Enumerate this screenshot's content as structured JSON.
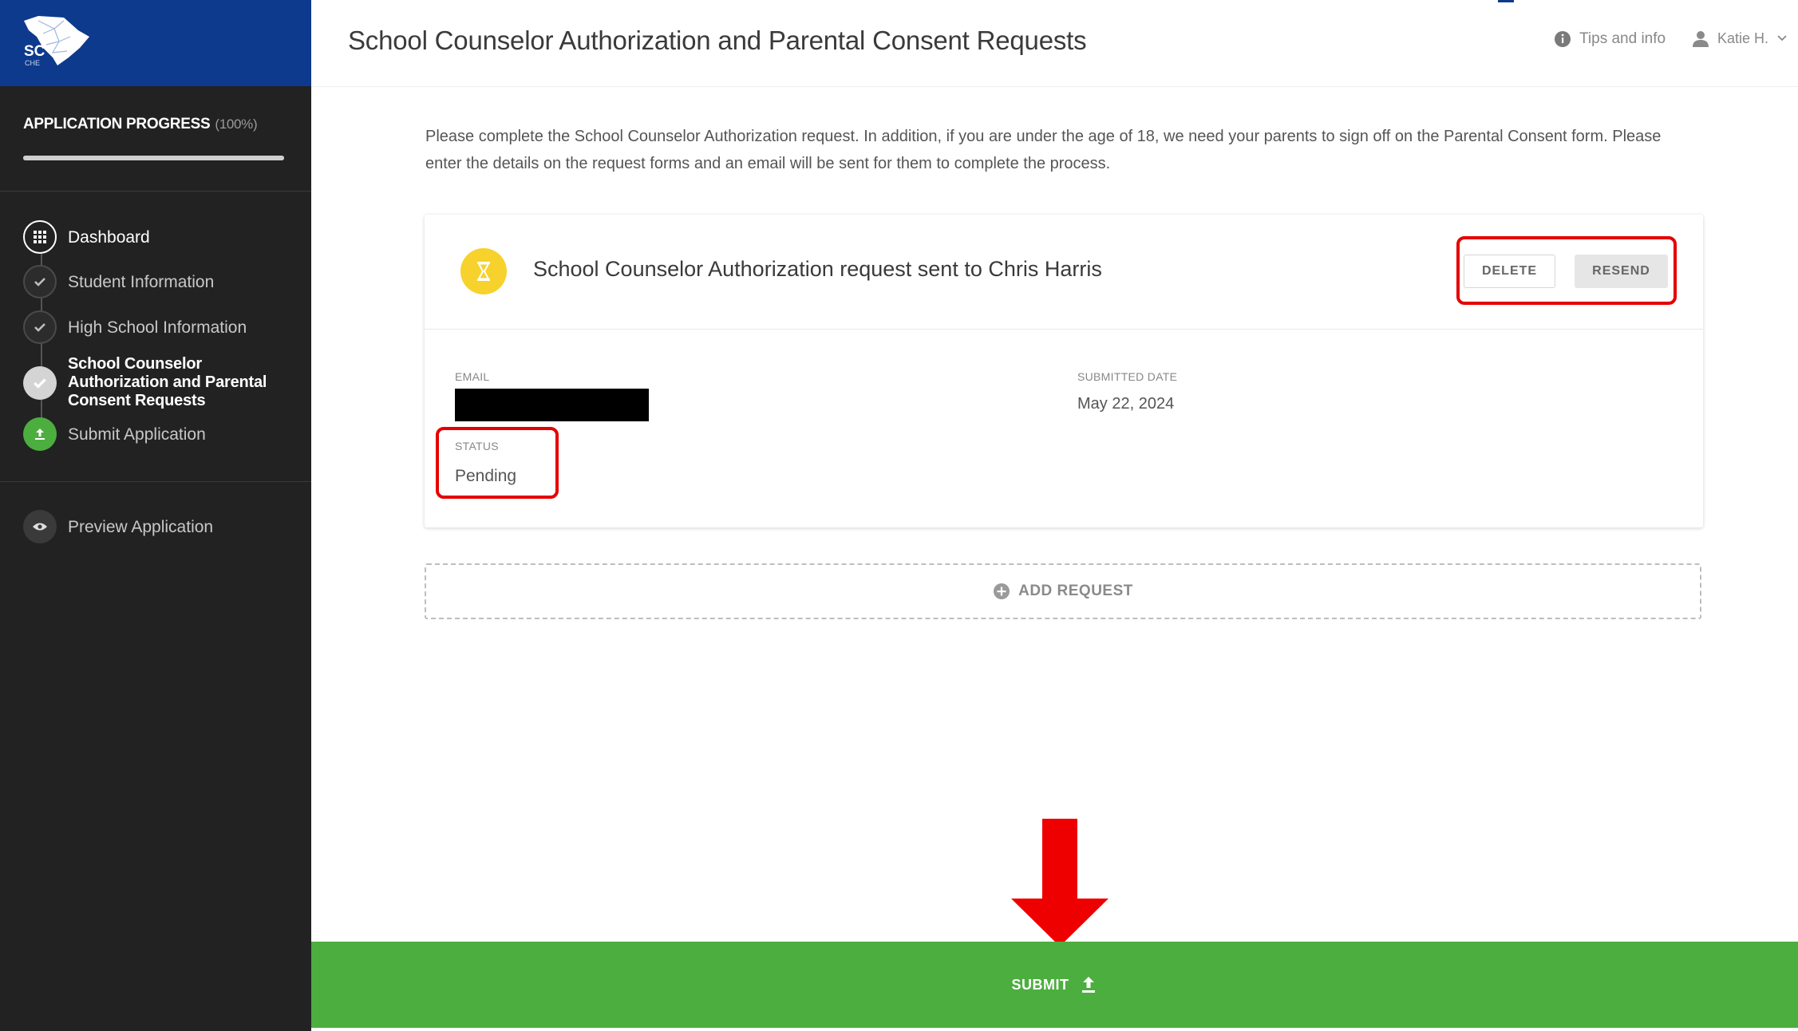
{
  "app": {
    "logo_text": "SC",
    "logo_subtext": "CHE"
  },
  "sidebar": {
    "progress_label": "APPLICATION PROGRESS",
    "progress_percent": "(100%)",
    "progress_value": 1.0,
    "items": [
      {
        "label": "Dashboard",
        "icon": "grid-icon",
        "state": "dashboard"
      },
      {
        "label": "Student Information",
        "icon": "check-icon",
        "state": "complete"
      },
      {
        "label": "High School Information",
        "icon": "check-icon",
        "state": "complete"
      },
      {
        "label": "School Counselor Authorization and Parental Consent Requests",
        "icon": "check-icon",
        "state": "active"
      },
      {
        "label": "Submit Application",
        "icon": "upload-icon",
        "state": "submit"
      }
    ],
    "preview": {
      "label": "Preview Application",
      "icon": "eye-icon"
    }
  },
  "header": {
    "title": "School Counselor Authorization and Parental Consent Requests",
    "tips_label": "Tips and info",
    "user_label": "Katie H."
  },
  "main": {
    "intro": "Please complete the School Counselor Authorization request. In addition, if you are under the age of 18, we need your parents to sign off on the Parental Consent form. Please enter the details on the request forms and an email will be sent for them to complete the process.",
    "request": {
      "title": "School Counselor Authorization request sent to Chris Harris",
      "delete_label": "DELETE",
      "resend_label": "RESEND",
      "email_label": "EMAIL",
      "submitted_label": "SUBMITTED DATE",
      "submitted_value": "May 22, 2024",
      "status_label": "STATUS",
      "status_value": "Pending"
    },
    "add_request_label": "ADD REQUEST",
    "submit_label": "SUBMIT"
  },
  "colors": {
    "logo_blue": "#0d3a8c",
    "sidebar_bg": "#222222",
    "submit_green": "#4cae3f",
    "pending_yellow": "#f7d22c",
    "highlight_red": "#e60000"
  }
}
